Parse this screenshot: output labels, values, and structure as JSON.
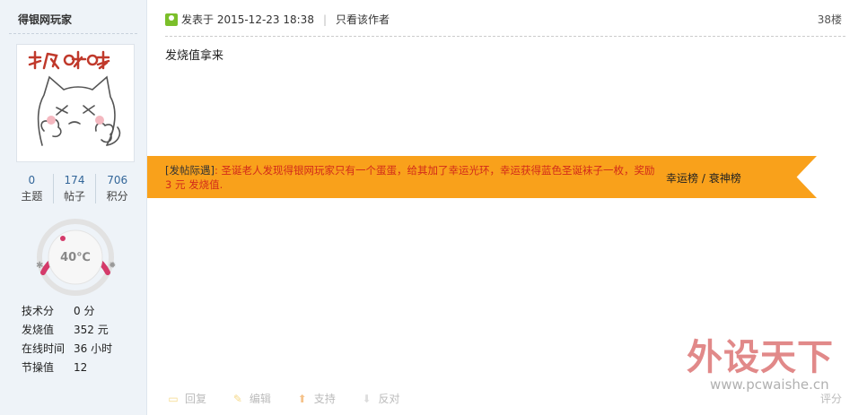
{
  "user": {
    "name": "得银网玩家",
    "stats": [
      {
        "num": "0",
        "label": "主题"
      },
      {
        "num": "174",
        "label": "帖子"
      },
      {
        "num": "706",
        "label": "积分"
      }
    ],
    "temperature": "40℃",
    "info": [
      {
        "key": "技术分",
        "value": "0 分"
      },
      {
        "key": "发烧值",
        "value": "352 元"
      },
      {
        "key": "在线时间",
        "value": "36 小时"
      },
      {
        "key": "节操值",
        "value": "12"
      }
    ]
  },
  "post": {
    "posted_at": "发表于 2015-12-23 18:38",
    "only_author": "只看该作者",
    "floor": "38楼",
    "content": "发烧值拿来"
  },
  "banner": {
    "tag": "[发帖际遇]",
    "text": ": 圣诞老人发现得银网玩家只有一个蛋蛋，给其加了幸运光环，幸运获得蓝色圣诞袜子一枚，奖励3 元 发烧值.",
    "link_lucky": "幸运榜",
    "sep": " / ",
    "link_unlucky": "衰神榜"
  },
  "actions": {
    "reply": "回复",
    "edit": "编辑",
    "support": "支持",
    "oppose": "反对",
    "rate": "评分"
  },
  "watermark": {
    "title": "外设天下",
    "url": "www.pcwaishe.cn"
  },
  "colors": {
    "banner": "#f9a11b",
    "banner_text": "#d22b1a",
    "side_bg": "#eef3f8",
    "gauge_ring": "#d43a6a"
  }
}
